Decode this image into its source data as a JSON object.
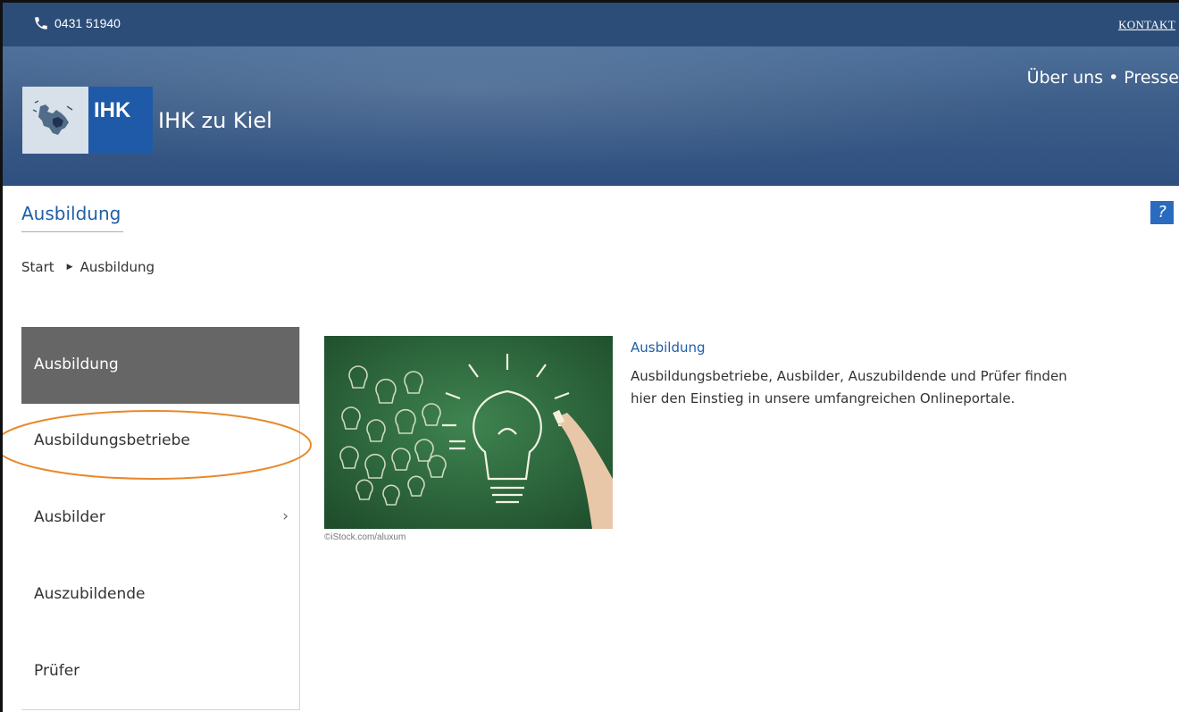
{
  "topbar": {
    "phone": "0431 51940",
    "phone_icon": "phone-icon",
    "kontakt": "KONTAKT"
  },
  "header": {
    "nav": [
      "Über uns",
      "Presse"
    ],
    "nav_separator": "•",
    "logo_text": "IHK",
    "org_name": "IHK zu Kiel"
  },
  "page": {
    "title": "Ausbildung",
    "help": "?"
  },
  "breadcrumb": {
    "items": [
      "Start",
      "Ausbildung"
    ],
    "separator_icon": "triangle-right-icon"
  },
  "sidebar": {
    "items": [
      {
        "label": "Ausbildung",
        "active": true
      },
      {
        "label": "Ausbildungsbetriebe",
        "highlighted": true
      },
      {
        "label": "Ausbilder",
        "has_submenu": true,
        "chevron": "›"
      },
      {
        "label": "Auszubildende"
      },
      {
        "label": "Prüfer"
      }
    ]
  },
  "teaser": {
    "image_caption": "©iStock.com/aluxum",
    "title": "Ausbildung",
    "text": "Ausbildungsbetriebe, Ausbilder, Auszubildende und Prüfer finden hier den Einstieg in unsere umfangreichen Onlineportale."
  },
  "colors": {
    "topbar": "#2c4d78",
    "banner": "#3d5e89",
    "link_blue": "#1f5ea8",
    "active_nav": "#666666",
    "highlight_ellipse": "#e8892b",
    "chalkboard": "#2e6b3f"
  }
}
